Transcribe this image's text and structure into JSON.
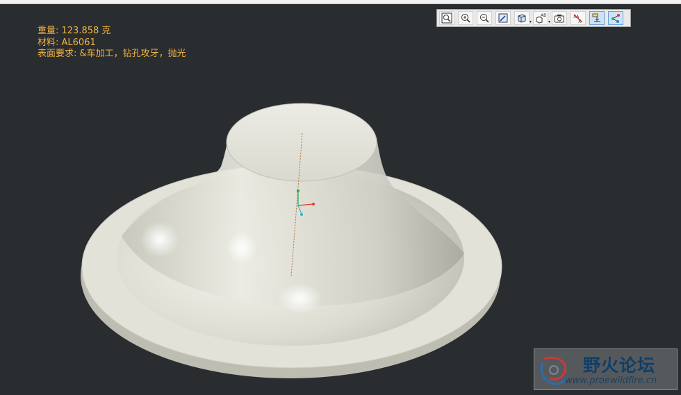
{
  "info": {
    "weight": "重量: 123.858 克",
    "material": "材料: AL6061",
    "surface": "表面要求: &车加工，钻孔攻牙，抛光"
  },
  "toolbar": {
    "buttons": [
      {
        "name": "zoom-fit-icon",
        "active": false
      },
      {
        "name": "zoom-in-icon",
        "active": false
      },
      {
        "name": "zoom-out-icon",
        "active": false
      },
      {
        "name": "repaint-icon",
        "active": false
      },
      {
        "name": "display-style-icon",
        "active": false,
        "dropdown": true
      },
      {
        "name": "saved-views-icon",
        "active": false,
        "dropdown": true
      },
      {
        "name": "snapshot-icon",
        "active": false
      },
      {
        "name": "annotation-display-icon",
        "active": false
      },
      {
        "name": "datum-display-icon",
        "active": true
      },
      {
        "name": "spin-center-icon",
        "active": true
      }
    ]
  },
  "watermark": {
    "title": "野火论坛",
    "url": "www.proewildfire.cn"
  },
  "colors": {
    "background": "#2a2d30",
    "info_text": "#f0b240",
    "model": "#dcdcd2"
  }
}
